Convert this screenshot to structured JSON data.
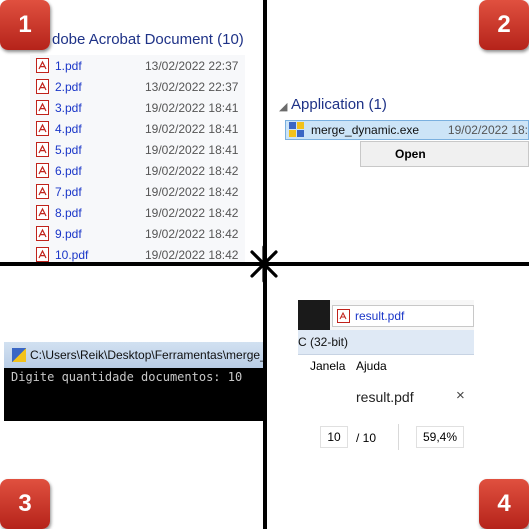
{
  "panel1": {
    "group_title": "dobe Acrobat Document (10)",
    "files": [
      {
        "name": "1.pdf",
        "date": "13/02/2022 22:37"
      },
      {
        "name": "2.pdf",
        "date": "13/02/2022 22:37"
      },
      {
        "name": "3.pdf",
        "date": "19/02/2022 18:41"
      },
      {
        "name": "4.pdf",
        "date": "19/02/2022 18:41"
      },
      {
        "name": "5.pdf",
        "date": "19/02/2022 18:41"
      },
      {
        "name": "6.pdf",
        "date": "19/02/2022 18:42"
      },
      {
        "name": "7.pdf",
        "date": "19/02/2022 18:42"
      },
      {
        "name": "8.pdf",
        "date": "19/02/2022 18:42"
      },
      {
        "name": "9.pdf",
        "date": "19/02/2022 18:42"
      },
      {
        "name": "10.pdf",
        "date": "19/02/2022 18:42"
      }
    ]
  },
  "panel2": {
    "group_title": "Application (1)",
    "exe_name": "merge_dynamic.exe",
    "exe_date": "19/02/2022 18:",
    "menu_open": "Open"
  },
  "panel3": {
    "window_title": "C:\\Users\\Reik\\Desktop\\Ferramentas\\merge_dyna",
    "console_text": "Digite quantidade documentos: 10"
  },
  "panel4": {
    "file_item": "result.pdf",
    "title_fragment": "C (32-bit)",
    "menu_janela": "Janela",
    "menu_ajuda": "Ajuda",
    "tab_title": "result.pdf",
    "close_glyph": "×",
    "page_current": "10",
    "page_sep": "/ 10",
    "zoom": "59,4%"
  },
  "badges": {
    "b1": "1",
    "b2": "2",
    "b3": "3",
    "b4": "4"
  },
  "colors": {
    "badge_red": "#c8362a",
    "link_blue": "#1a36c8",
    "group_blue": "#1e3287",
    "selection": "#cce4f7"
  }
}
